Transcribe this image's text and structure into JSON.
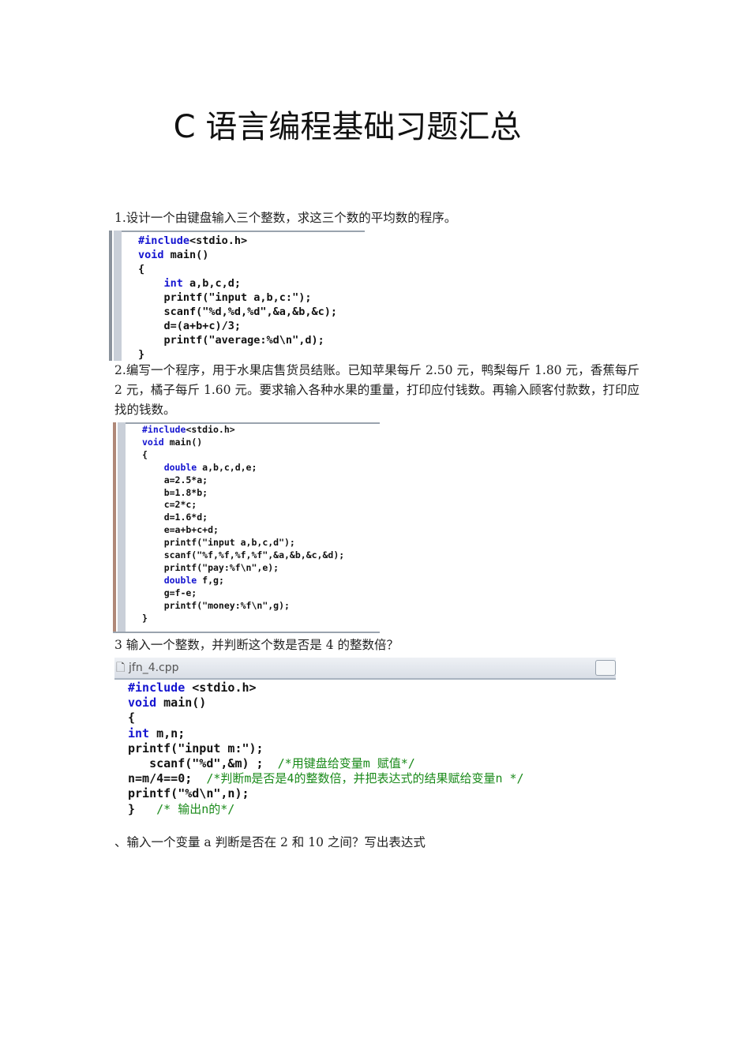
{
  "title": "C 语言编程基础习题汇总",
  "questions": [
    "1.设计一个由键盘输入三个整数，求这三个数的平均数的程序。",
    "2.编写一个程序，用于水果店售货员结账。已知苹果每斤 2.50 元，鸭梨每斤 1.80 元，香蕉每斤 2 元，橘子每斤 1.60 元。要求输入各种水果的重量，打印应付钱数。再输入顾客付款数，打印应找的钱数。",
    "3 输入一个整数，并判断这个数是否是 4 的整数倍？",
    "、输入一个变量 a  判断是否在 2 和 10 之间？写出表达式"
  ],
  "code1": [
    {
      "kw": "#include",
      "text": "<stdio.h>"
    },
    {
      "kw": "void",
      "text": " main()"
    },
    {
      "kw": "",
      "text": "{"
    },
    {
      "kw": "    int",
      "text": " a,b,c,d;"
    },
    {
      "kw": "",
      "text": "    printf(\"input a,b,c:\");"
    },
    {
      "kw": "",
      "text": "    scanf(\"%d,%d,%d\",&a,&b,&c);"
    },
    {
      "kw": "",
      "text": "    d=(a+b+c)/3;"
    },
    {
      "kw": "",
      "text": "    printf(\"average:%d\\n\",d);"
    },
    {
      "kw": "",
      "text": "}"
    }
  ],
  "code2": [
    {
      "kw": "#include",
      "text": "<stdio.h>"
    },
    {
      "kw": "void",
      "text": " main()"
    },
    {
      "kw": "",
      "text": "{"
    },
    {
      "kw": "    double",
      "text": " a,b,c,d,e;"
    },
    {
      "kw": "",
      "text": "    a=2.5*a;"
    },
    {
      "kw": "",
      "text": "    b=1.8*b;"
    },
    {
      "kw": "",
      "text": "    c=2*c;"
    },
    {
      "kw": "",
      "text": "    d=1.6*d;"
    },
    {
      "kw": "",
      "text": "    e=a+b+c+d;"
    },
    {
      "kw": "",
      "text": "    printf(\"input a,b,c,d\");"
    },
    {
      "kw": "",
      "text": "    scanf(\"%f,%f,%f,%f\",&a,&b,&c,&d);"
    },
    {
      "kw": "",
      "text": "    printf(\"pay:%f\\n\",e);"
    },
    {
      "kw": "    double",
      "text": " f,g;"
    },
    {
      "kw": "",
      "text": "    g=f-e;"
    },
    {
      "kw": "",
      "text": "    printf(\"money:%f\\n\",g);"
    },
    {
      "kw": "",
      "text": "}"
    }
  ],
  "code3": {
    "filename": "jfn_4.cpp",
    "lines": [
      {
        "kw": "#include",
        "text": " <stdio.h>",
        "cm": ""
      },
      {
        "kw": "void",
        "text": " main()",
        "cm": ""
      },
      {
        "kw": "",
        "text": "{",
        "cm": ""
      },
      {
        "kw": "int",
        "text": " m,n;",
        "cm": ""
      },
      {
        "kw": "",
        "text": "printf(\"input m:\");",
        "cm": ""
      },
      {
        "kw": "",
        "text": "   scanf(\"%d\",&m) ;  ",
        "cm": "/*用键盘给变量m 赋值*/"
      },
      {
        "kw": "",
        "text": "n=m/4==0;  ",
        "cm": "/*判断m是否是4的整数倍，并把表达式的结果赋给变量n */"
      },
      {
        "kw": "",
        "text": "printf(\"%d\\n\",n);",
        "cm": ""
      },
      {
        "kw": "",
        "text": "}   ",
        "cm": "/* 输出n的*/"
      }
    ]
  }
}
